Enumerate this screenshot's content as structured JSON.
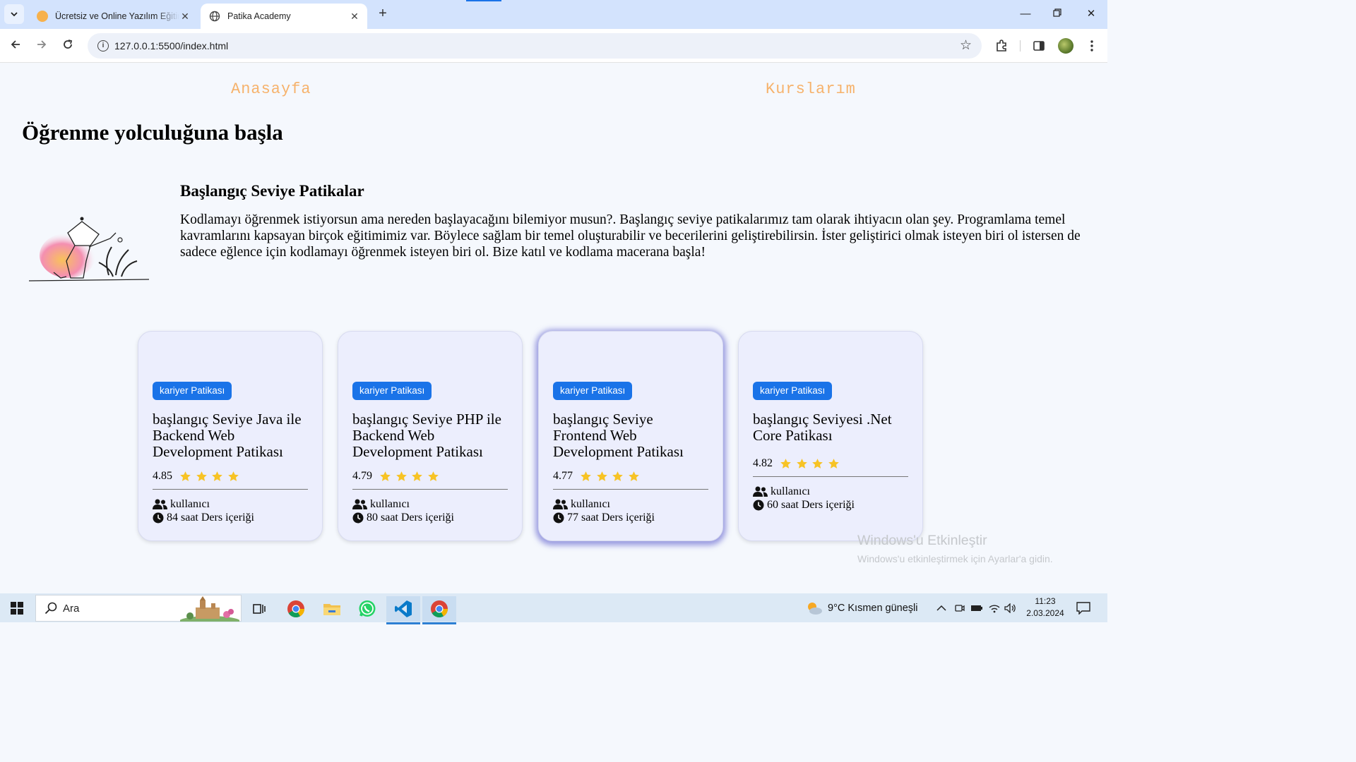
{
  "browser": {
    "tabs": [
      {
        "title": "Ücretsiz ve Online Yazılım Eğitimi",
        "active": false
      },
      {
        "title": "Patika Academy",
        "active": true
      }
    ],
    "address": "127.0.0.1:5500/index.html"
  },
  "nav": {
    "home": "Anasayfa",
    "courses": "Kurslarım"
  },
  "page": {
    "title": "Öğrenme yolculuğuna başla",
    "intro_heading": "Başlangıç Seviye Patikalar",
    "intro_text": "Kodlamayı öğrenmek istiyorsun ama nereden başlayacağını bilemiyor musun?. Başlangıç seviye patikalarımız tam olarak ihtiyacın olan şey. Programlama temel kavramlarını kapsayan birçok eğitimimiz var. Böylece sağlam bir temel oluşturabilir ve becerilerini geliştirebilirsin. İster geliştirici olmak isteyen biri ol istersen de sadece eğlence için kodlamayı öğrenmek isteyen biri ol. Bize katıl ve kodlama macerana başla!"
  },
  "cards": [
    {
      "badge": "kariyer Patikası",
      "title": "başlangıç Seviye Java ile Backend Web Development Patikası",
      "rating": "4.85",
      "stars": 4,
      "users": "kullanıcı",
      "duration": "84 saat Ders içeriği"
    },
    {
      "badge": "kariyer Patikası",
      "title": "başlangıç Seviye PHP ile Backend Web Development Patikası",
      "rating": "4.79",
      "stars": 4,
      "users": "kullanıcı",
      "duration": "80 saat Ders içeriği"
    },
    {
      "badge": "kariyer Patikası",
      "title": "başlangıç Seviye Frontend Web Development Patikası",
      "rating": "4.77",
      "stars": 4,
      "users": "kullanıcı",
      "duration": "77 saat Ders içeriği"
    },
    {
      "badge": "kariyer Patikası",
      "title": "başlangıç Seviyesi .Net Core Patikası",
      "rating": "4.82",
      "stars": 4,
      "users": "kullanıcı",
      "duration": "60 saat Ders içeriği"
    }
  ],
  "watermark": {
    "title": "Windows'u Etkinleştir",
    "subtitle": "Windows'u etkinleştirmek için Ayarlar'a gidin."
  },
  "taskbar": {
    "search_placeholder": "Ara",
    "weather": "9°C  Kısmen güneşli",
    "time": "11:23",
    "date": "2.03.2024"
  },
  "colors": {
    "accent": "#1a73e8",
    "nav_link": "#f6b26b",
    "star": "#f7c325",
    "card_bg": "#eceefd"
  }
}
